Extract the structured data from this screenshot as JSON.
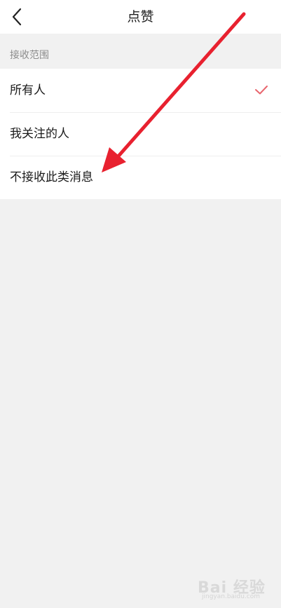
{
  "header": {
    "title": "点赞"
  },
  "section": {
    "label": "接收范围"
  },
  "options": [
    {
      "label": "所有人",
      "selected": true
    },
    {
      "label": "我关注的人",
      "selected": false
    },
    {
      "label": "不接收此类消息",
      "selected": false
    }
  ],
  "icons": {
    "back": "chevron-left-icon",
    "check": "checkmark-icon"
  },
  "colors": {
    "check": "#e8656d",
    "arrow": "#e8212f"
  },
  "watermark": {
    "brand": "Bai 经验",
    "url": "jingyan.baidu.com"
  }
}
